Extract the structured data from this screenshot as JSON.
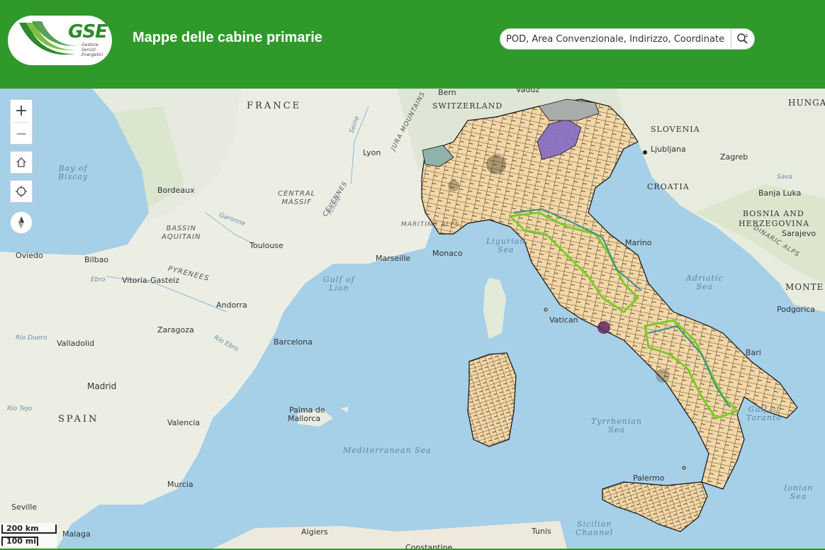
{
  "header": {
    "logo_text": "GSE",
    "logo_subtitle": [
      "Gestore",
      "Servizi",
      "Energetici"
    ],
    "title": "Mappe delle cabine primarie",
    "brand_color": "#2f9a2a"
  },
  "search": {
    "placeholder": "POD, Area Convenzionale, Indirizzo, Coordinate",
    "icon": "search-icon"
  },
  "map_controls": {
    "zoom_in": "+",
    "zoom_out": "—",
    "home_icon": "home-icon",
    "locate_icon": "locate-icon",
    "compass_icon": "compass-icon"
  },
  "scale": {
    "metric": "200 km",
    "imperial": "100 mi"
  },
  "labels": {
    "countries": [
      "FRANCE",
      "SWITZERLAND",
      "SLOVENIA",
      "CROATIA",
      "BOSNIA AND",
      "HERZEGOVINA",
      "SPAIN",
      "HUNGA",
      "MONTE"
    ],
    "cities": [
      "Bern",
      "Vaduz",
      "Lyon",
      "Ljubljana",
      "Zagreb",
      "Bordeaux",
      "Banja Luka",
      "Sarajevo",
      "Toulouse",
      "Oviedo",
      "Bilbao",
      "Vitoria-Gasteiz",
      "Marseille",
      "Monaco",
      "Marino",
      "Andorra",
      "Zaragoza",
      "Valladolid",
      "Barcelona",
      "Vatican",
      "Podgorica",
      "Bari",
      "Madrid",
      "Palma de",
      "Mallorca",
      "Valencia",
      "Murcia",
      "Palermo",
      "Seville",
      "Malaga",
      "Algiers",
      "Tunis",
      "Constantine"
    ],
    "seas": [
      "Bay of",
      "Biscay",
      "Ligurian",
      "Sea",
      "Gulf of",
      "Lion",
      "Adriatic",
      "Sea",
      "Tyrrhenian",
      "Sea",
      "Mediterranean Sea",
      "Gulf of",
      "Taranto",
      "Ionian",
      "Sea",
      "Sicilian",
      "Channel"
    ],
    "physical": [
      "CENTRAL",
      "MASSIF",
      "BASSIN",
      "AQUITAIN",
      "PYRENEES",
      "JURA MOUNTAINS",
      "CEVENNES",
      "DINARIC ALPS",
      "MARITIME ALPS"
    ],
    "rivers": [
      "Seine",
      "Rhône",
      "Garonne",
      "Ebro",
      "Río Ebro",
      "Río Duero",
      "Río Tejo",
      "Sava"
    ]
  },
  "legend_colors": {
    "areas": "#f3d7a6",
    "boundaries": "#111111",
    "highlight_green": "#7acc29",
    "highlight_teal": "#3a8f8a",
    "highlight_purple": "#8a6fc2",
    "highlight_grey": "#9aa5a3"
  }
}
